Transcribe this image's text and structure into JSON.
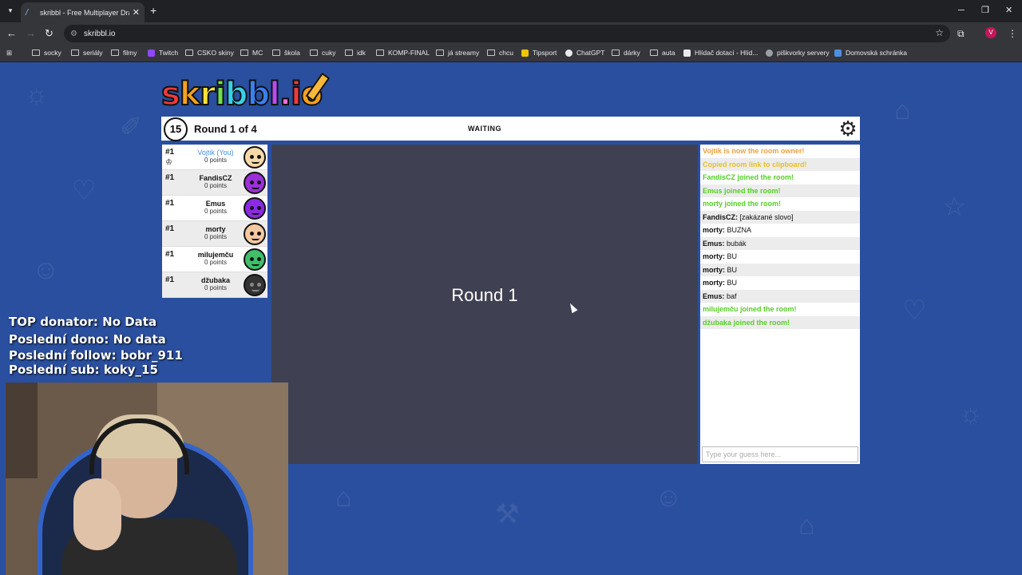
{
  "browser": {
    "tab_title": "skribbl - Free Multiplayer Draw",
    "tab_favicon": "/",
    "url": "skribbl.io",
    "profile_initial": "V",
    "bookmarks": [
      "socky",
      "seriály",
      "filmy",
      "Twitch",
      "CSKO skiny",
      "MC",
      "škola",
      "cuky",
      "idk",
      "KOMP-FINAL",
      "já streamy",
      "chcu",
      "Tipsport",
      "ChatGPT",
      "dárky",
      "auta",
      "Hlídač dotací - Hlíd...",
      "piškvorky servery",
      "Domovská schránka"
    ]
  },
  "game": {
    "logo": "skribbl.io",
    "timer": "15",
    "round_text": "Round 1 of 4",
    "status": "WAITING",
    "canvas_message": "Round 1",
    "players": [
      {
        "rank": "#1",
        "name": "Vojtik (You)",
        "points": "0 points",
        "is_owner": true,
        "avatar_color": "#f7d9a8"
      },
      {
        "rank": "#1",
        "name": "FandisCZ",
        "points": "0 points",
        "is_owner": false,
        "avatar_color": "#9b30d9"
      },
      {
        "rank": "#1",
        "name": "Emus",
        "points": "0 points",
        "is_owner": false,
        "avatar_color": "#8a2be2"
      },
      {
        "rank": "#1",
        "name": "morty",
        "points": "0 points",
        "is_owner": false,
        "avatar_color": "#f4c8a0"
      },
      {
        "rank": "#1",
        "name": "milujemču",
        "points": "0 points",
        "is_owner": false,
        "avatar_color": "#3fbf6a"
      },
      {
        "rank": "#1",
        "name": "džubaka",
        "points": "0 points",
        "is_owner": false,
        "avatar_color": "#333333"
      }
    ],
    "chat": [
      {
        "type": "orange",
        "text": "Vojtik is now the room owner!"
      },
      {
        "type": "yellow",
        "text": "Copied room link to clipboard!"
      },
      {
        "type": "green",
        "text": "FandisCZ joined the room!"
      },
      {
        "type": "green",
        "text": "Emus joined the room!"
      },
      {
        "type": "green",
        "text": "morty joined the room!"
      },
      {
        "type": "msg",
        "who": "FandisCZ:",
        "text": " [zakázané slovo]"
      },
      {
        "type": "msg",
        "who": "morty:",
        "text": " BUZNA"
      },
      {
        "type": "msg",
        "who": "Emus:",
        "text": " bubák"
      },
      {
        "type": "msg",
        "who": "morty:",
        "text": " BU"
      },
      {
        "type": "msg",
        "who": "morty:",
        "text": " BU"
      },
      {
        "type": "msg",
        "who": "morty:",
        "text": " BU"
      },
      {
        "type": "msg",
        "who": "Emus:",
        "text": " baf"
      },
      {
        "type": "green",
        "text": "milujemču joined the room!"
      },
      {
        "type": "green",
        "text": "džubaka joined the room!"
      }
    ],
    "chat_placeholder": "Type your guess here..."
  },
  "overlay": {
    "top_donator": "TOP donator: No Data",
    "last_dono": "Poslední dono: No data",
    "last_follow": "Poslední follow: bobr_911",
    "last_sub": "Poslední sub: koky_15"
  }
}
